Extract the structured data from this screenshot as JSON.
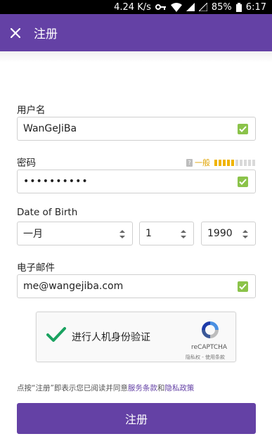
{
  "status_bar": {
    "speed": "4.24 K/s",
    "battery": "85%",
    "time": "6:17",
    "icons": [
      "key-icon",
      "wifi-icon",
      "cell-signal-icon",
      "cell-signal-empty-icon",
      "battery-icon"
    ]
  },
  "app_bar": {
    "title": "注册",
    "close_icon": "close-icon"
  },
  "form": {
    "username": {
      "label": "用户名",
      "value": "WanGeJiBa",
      "valid": true
    },
    "password": {
      "label": "密码",
      "value": "••••••••••",
      "valid": true,
      "strength": {
        "label": "一般",
        "filled": 5,
        "total": 10
      }
    },
    "birth": {
      "label": "Date of Birth",
      "month": "一月",
      "day": "1",
      "year": "1990"
    },
    "email": {
      "label": "电子邮件",
      "value": "me@wangejiba.com",
      "valid": true
    }
  },
  "recaptcha": {
    "label": "进行人机身份验证",
    "brand": "reCAPTCHA",
    "links": "隐私权 - 使用条款",
    "checked": true
  },
  "terms": {
    "prefix": "点按“注册”即表示您已阅读并同意",
    "tos_link": "服务条款",
    "and": "和",
    "privacy_link": "隐私政策"
  },
  "submit_label": "注册",
  "colors": {
    "brand": "#6441a5",
    "valid": "#8bc34a",
    "strength": "#f0b400"
  }
}
